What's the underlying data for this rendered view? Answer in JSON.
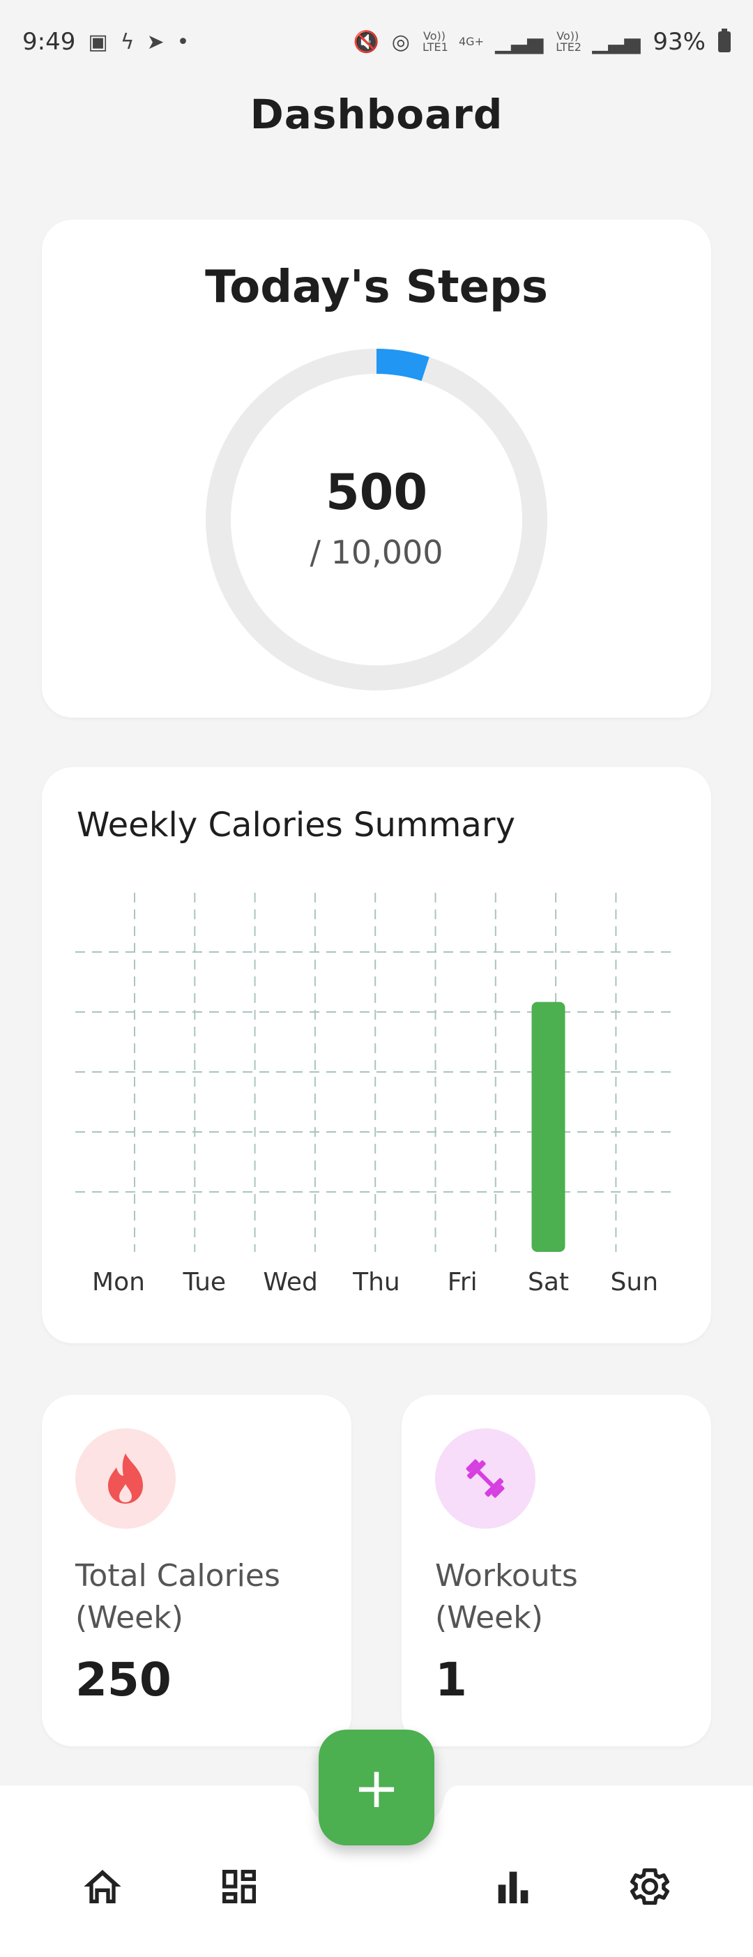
{
  "status_bar": {
    "time": "9:49",
    "network1": "Vo)) LTE1",
    "network2": "4G+",
    "network3": "Vo)) LTE2",
    "battery": "93%"
  },
  "page": {
    "title": "Dashboard"
  },
  "steps": {
    "title": "Today's Steps",
    "value": "500",
    "goal_label": "/ 10,000",
    "progress_fraction": 0.05,
    "accent_color": "#2196f3",
    "track_color": "#ebebeb"
  },
  "calories_chart": {
    "title": "Weekly Calories Summary",
    "bar_color": "#4caf50",
    "chart_data": {
      "type": "bar",
      "categories": [
        "Mon",
        "Tue",
        "Wed",
        "Thu",
        "Fri",
        "Sat",
        "Sun"
      ],
      "values": [
        0,
        0,
        0,
        0,
        0,
        250,
        0
      ],
      "ylim": [
        0,
        300
      ],
      "grid": true
    }
  },
  "stats": {
    "calories": {
      "label_line1": "Total Calories",
      "label_line2": "(Week)",
      "value": "250",
      "icon": "fire-icon",
      "icon_bg": "#fde3e3",
      "icon_color": "#f05454"
    },
    "workouts": {
      "label_line1": "Workouts",
      "label_line2": "(Week)",
      "value": "1",
      "icon": "dumbbell-icon",
      "icon_bg": "#f7ddf9",
      "icon_color": "#d63fe0"
    }
  },
  "fab": {
    "label": "+",
    "color": "#4caf50"
  },
  "nav": {
    "items": [
      "home-icon",
      "dashboard-icon",
      "stats-icon",
      "settings-icon"
    ]
  }
}
